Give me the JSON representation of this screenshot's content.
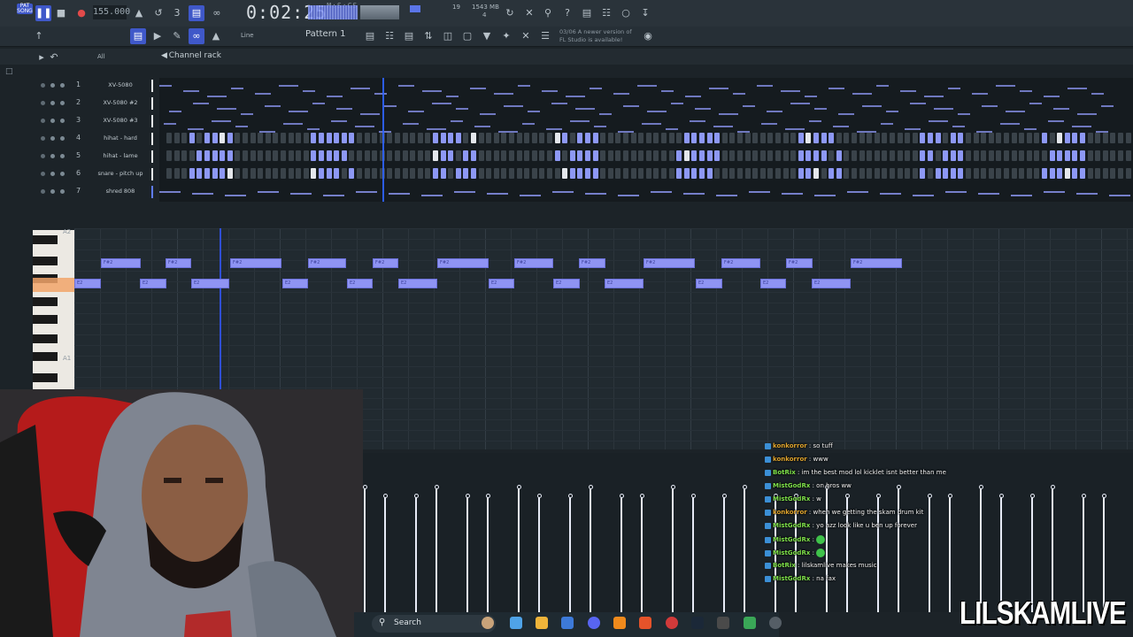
{
  "toolbar": {
    "pat_label": "PAT SONG",
    "tempo": "155.000",
    "time": "0:02:25",
    "time_unit": "M:S:CS",
    "memory": "1543 MB",
    "memory_sub": "4",
    "cpu": "19",
    "pattern_name": "Pattern 1",
    "snap_label": "Line",
    "update_notice_line1": "03/06  A newer version of",
    "update_notice_line2": "FL Studio is available!"
  },
  "channel_rack": {
    "title": "Channel rack",
    "filter": "All",
    "channels": [
      {
        "num": "1",
        "name": "XV-5080"
      },
      {
        "num": "2",
        "name": "XV-5080 #2"
      },
      {
        "num": "3",
        "name": "XV-5080 #3"
      },
      {
        "num": "4",
        "name": "hihat - hard"
      },
      {
        "num": "5",
        "name": "hihat - lame"
      },
      {
        "num": "6",
        "name": "snare - pitch up"
      },
      {
        "num": "7",
        "name": "shred 808"
      }
    ]
  },
  "piano_roll": {
    "octave_labels": [
      "A2",
      "A1"
    ],
    "note_label_upper": "F#2",
    "note_label_lower": "E2"
  },
  "chat": {
    "messages": [
      {
        "user": "konkorror",
        "text": "so tuff",
        "color": "#e0a52e"
      },
      {
        "user": "konkorror",
        "text": "www",
        "color": "#e0a52e"
      },
      {
        "user": "BotRix",
        "text": "im the best mod lol kicklet isnt better than me",
        "color": "#7ee04a"
      },
      {
        "user": "MistGodRx",
        "text": "on bros ww",
        "color": "#7ee04a"
      },
      {
        "user": "MistGodRx",
        "text": "w",
        "color": "#7ee04a"
      },
      {
        "user": "konkorror",
        "text": "when we getting the skam drum kit",
        "color": "#e0a52e"
      },
      {
        "user": "MistGodRx",
        "text": "yo azz look like u ben up forever",
        "color": "#7ee04a"
      },
      {
        "user": "MistGodRx",
        "text": "",
        "color": "#7ee04a"
      },
      {
        "user": "MistGodRx",
        "text": "",
        "color": "#7ee04a"
      },
      {
        "user": "BotRix",
        "text": "lilskamlive makes music",
        "color": "#7ee04a"
      },
      {
        "user": "MistGodRx",
        "text": "na fax",
        "color": "#7ee04a"
      }
    ]
  },
  "taskbar": {
    "search_placeholder": "Search"
  },
  "brand": "LILSKAMLIVE",
  "colors": {
    "accent": "#3f58c9",
    "note": "#8f94f3",
    "step_on": "#8d98f5",
    "step_light": "#dfe3ea",
    "highlight_key": "#f2a56a"
  }
}
